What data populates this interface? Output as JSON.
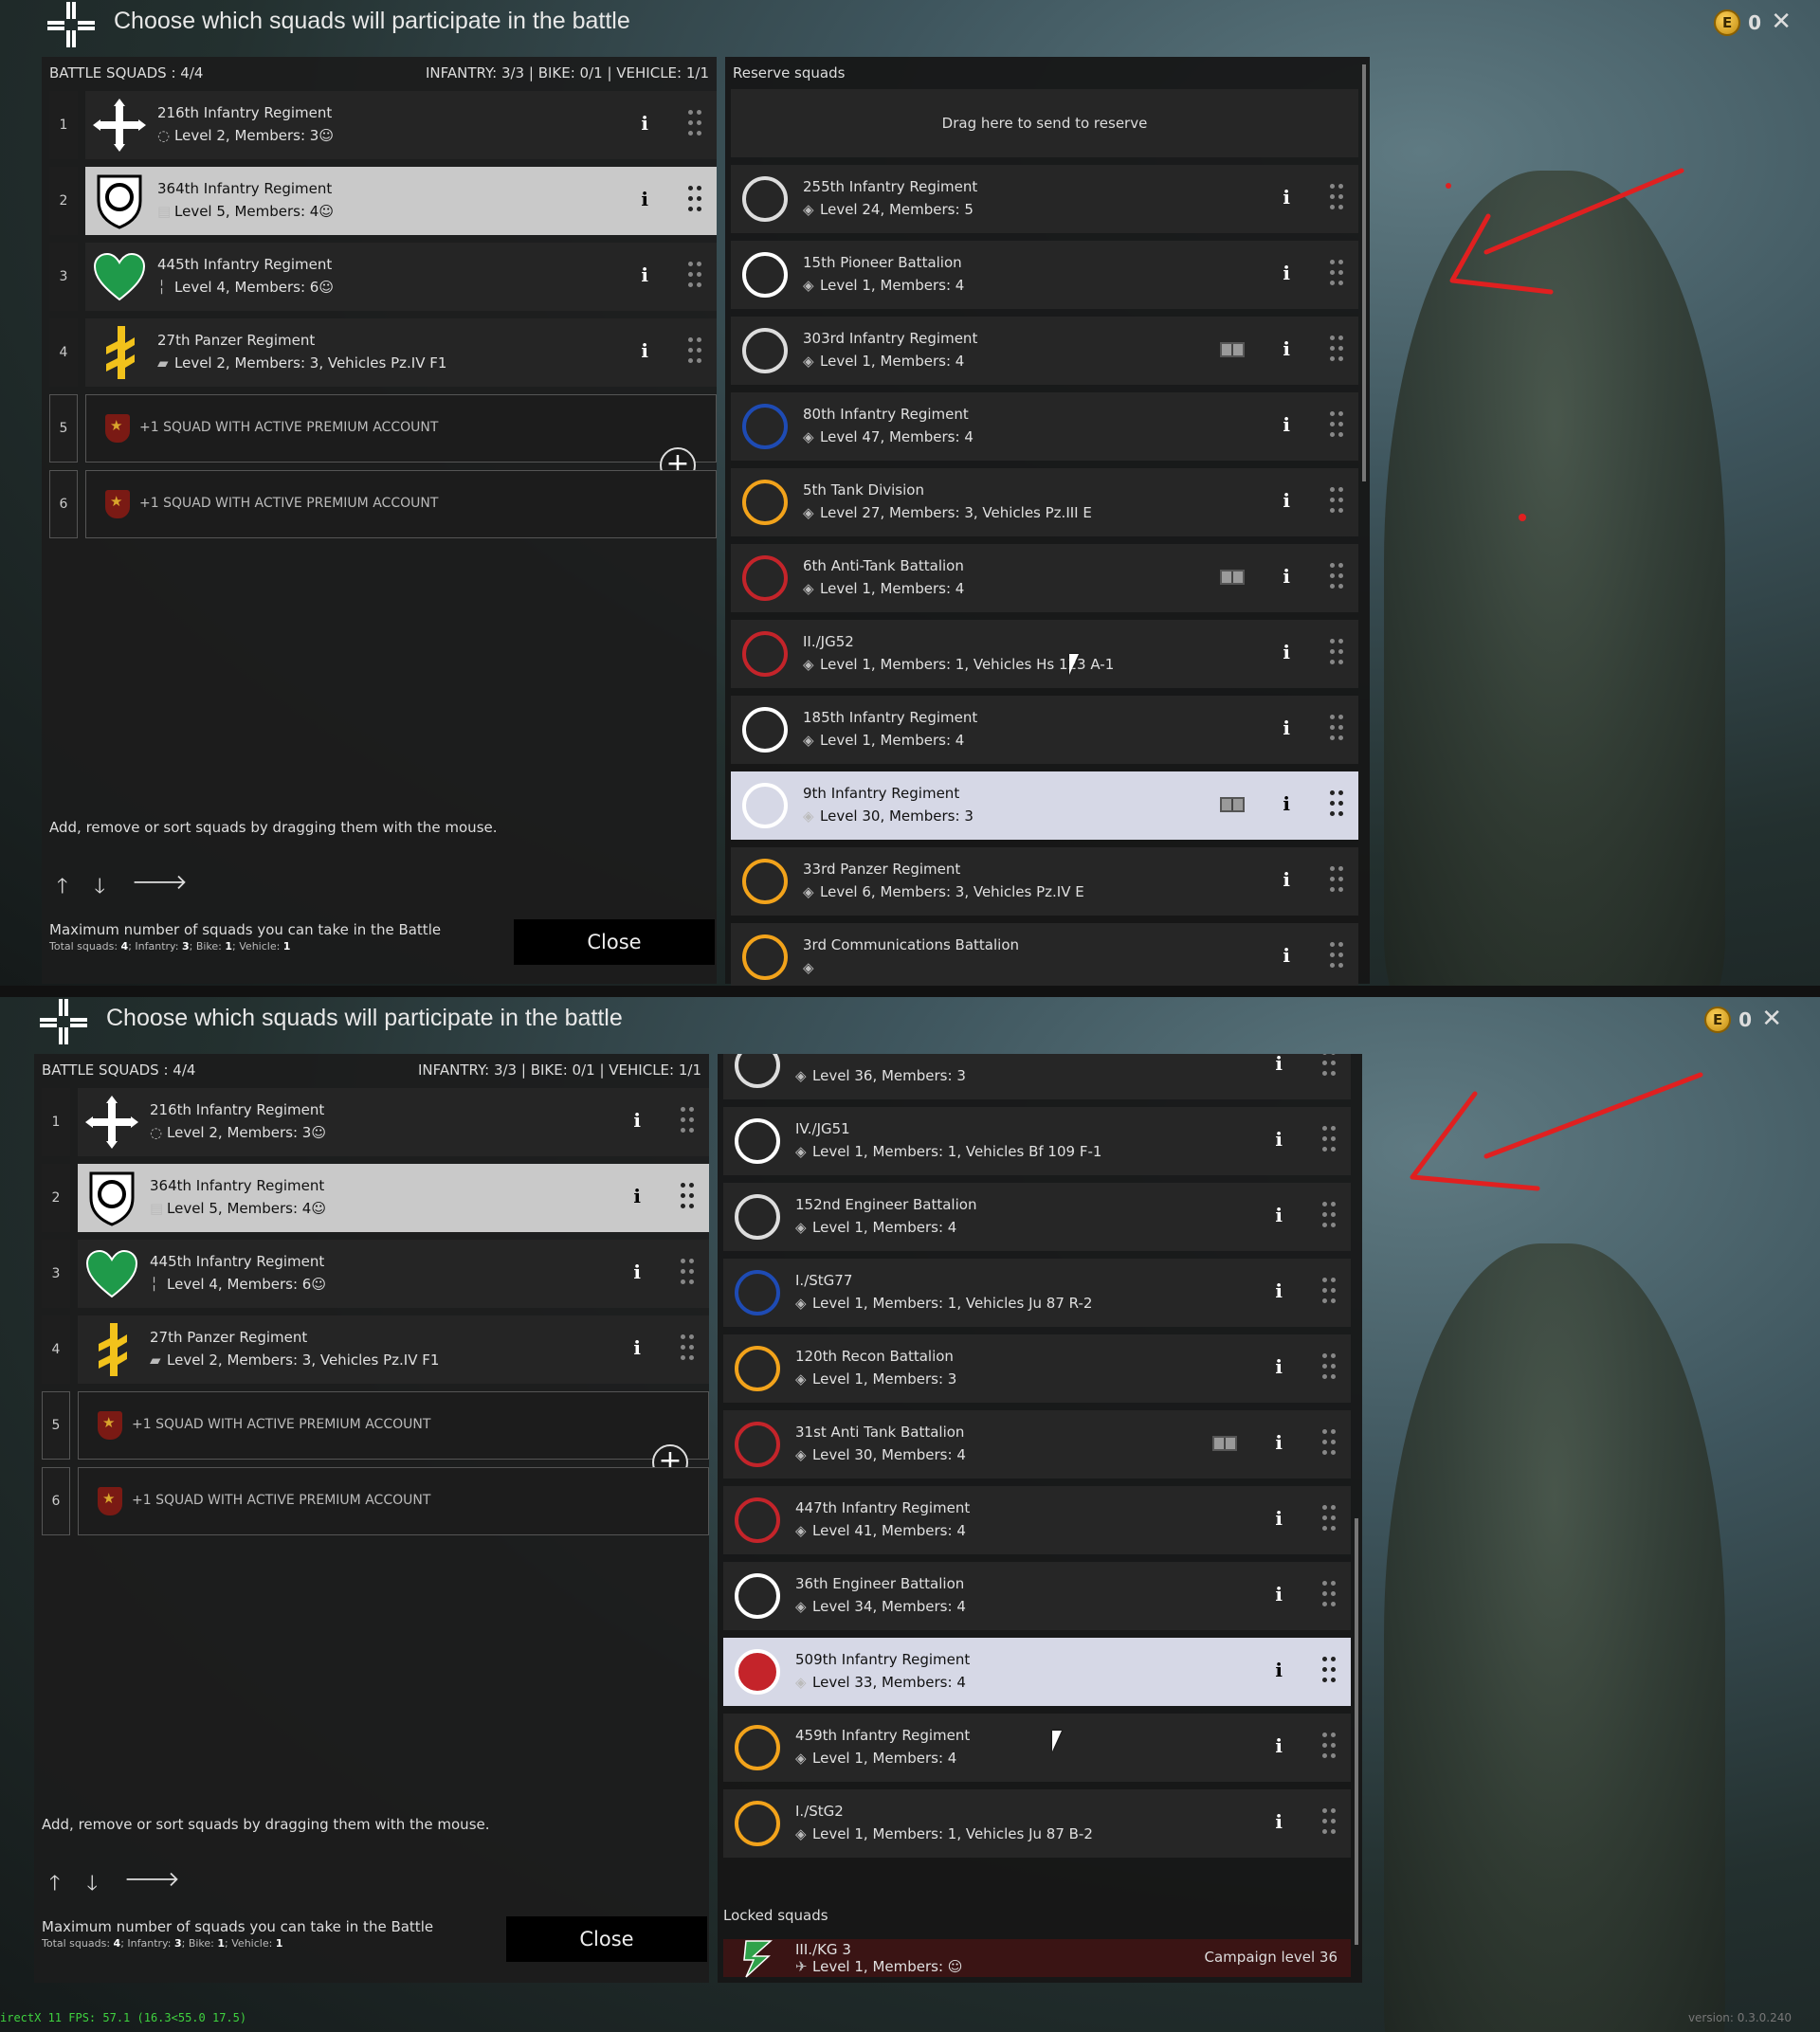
{
  "screenshots": [
    {
      "title": "Choose which squads will participate in the battle",
      "coins": "0",
      "battle_label": "BATTLE SQUADS : 4/4",
      "battle_counts": "INFANTRY: 3/3 | BIKE: 0/1 | VEHICLE: 1/1",
      "battle_squads": [
        {
          "num": "1",
          "name": "216th Infantry Regiment",
          "sub": "Level 2, Members: 3",
          "icon": "infantry-icon",
          "emblem": "white-cross"
        },
        {
          "num": "2",
          "name": "364th Infantry Regiment",
          "sub": "Level 5, Members: 4",
          "icon": "engineer-icon",
          "emblem": "shield-circle",
          "selected": true
        },
        {
          "num": "3",
          "name": "445th Infantry Regiment",
          "sub": "Level 4, Members: 6",
          "icon": "rifle-icon",
          "emblem": "green-heart"
        },
        {
          "num": "4",
          "name": "27th Panzer Regiment",
          "sub": "Level 2, Members: 3, Vehicles Pz.IV F1",
          "icon": "tank-icon",
          "emblem": "yellow-rune"
        }
      ],
      "premium_slots": [
        {
          "num": "5",
          "text": "+1 SQUAD WITH ACTIVE PREMIUM ACCOUNT"
        },
        {
          "num": "6",
          "text": "+1 SQUAD WITH ACTIVE PREMIUM ACCOUNT"
        }
      ],
      "hint": "Add, remove or sort squads by dragging them with the mouse.",
      "max_title": "Maximum number of squads you can take in the Battle",
      "max_sub_label": "Total squads:",
      "max_total": "4",
      "max_inf_label": "Infantry:",
      "max_inf": "3",
      "max_bike_label": "Bike:",
      "max_bike": "1",
      "max_veh_label": "Vehicle:",
      "max_veh": "1",
      "close": "Close",
      "reserve_label": "Reserve squads",
      "drop_zone": "Drag here to send to reserve",
      "reserve": [
        {
          "name": "255th Infantry Regiment",
          "sub": "Level 24, Members: 5"
        },
        {
          "name": "15th Pioneer Battalion",
          "sub": "Level 1, Members: 4"
        },
        {
          "name": "303rd Infantry Regiment",
          "sub": "Level 1, Members: 4",
          "book": true
        },
        {
          "name": "80th Infantry Regiment",
          "sub": "Level 47, Members: 4"
        },
        {
          "name": "5th Tank Division",
          "sub": "Level 27, Members: 3, Vehicles Pz.III E"
        },
        {
          "name": "6th Anti-Tank Battalion",
          "sub": "Level 1, Members: 4",
          "book": true
        },
        {
          "name": "II./JG52",
          "sub": "Level 1, Members: 1, Vehicles Hs 123 A-1"
        },
        {
          "name": "185th Infantry Regiment",
          "sub": "Level 1, Members: 4"
        },
        {
          "name": "9th Infantry Regiment",
          "sub": "Level 30, Members: 3",
          "book": true,
          "selected": true
        },
        {
          "name": "33rd Panzer Regiment",
          "sub": "Level 6, Members: 3, Vehicles Pz.IV E"
        },
        {
          "name": "3rd Communications Battalion",
          "sub": ""
        }
      ]
    },
    {
      "title": "Choose which squads will participate in the battle",
      "coins": "0",
      "battle_label": "BATTLE SQUADS : 4/4",
      "battle_counts": "INFANTRY: 3/3 | BIKE: 0/1 | VEHICLE: 1/1",
      "hint": "Add, remove or sort squads by dragging them with the mouse.",
      "max_title": "Maximum number of squads you can take in the Battle",
      "close": "Close",
      "reserve": [
        {
          "name": "",
          "sub": "Level 36, Members: 3"
        },
        {
          "name": "IV./JG51",
          "sub": "Level 1, Members: 1, Vehicles Bf 109 F-1"
        },
        {
          "name": "152nd Engineer Battalion",
          "sub": "Level 1, Members: 4"
        },
        {
          "name": "I./StG77",
          "sub": "Level 1, Members: 1, Vehicles Ju 87 R-2"
        },
        {
          "name": "120th Recon Battalion",
          "sub": "Level 1, Members: 3"
        },
        {
          "name": "31st Anti Tank Battalion",
          "sub": "Level 30, Members: 4",
          "book": true
        },
        {
          "name": "447th Infantry Regiment",
          "sub": "Level 41, Members: 4"
        },
        {
          "name": "36th Engineer Battalion",
          "sub": "Level 34, Members: 4"
        },
        {
          "name": "509th Infantry Regiment",
          "sub": "Level 33, Members: 4",
          "selected": true
        },
        {
          "name": "459th Infantry Regiment",
          "sub": "Level 1, Members: 4"
        },
        {
          "name": "I./StG2",
          "sub": "Level 1, Members: 1, Vehicles Ju 87 B-2"
        }
      ],
      "locked_label": "Locked squads",
      "locked": [
        {
          "name": "III./KG 3",
          "sub": "Level 1, Members: ",
          "requirement": "Campaign level 36"
        }
      ]
    }
  ],
  "footer": {
    "fps": "irectX 11 FPS: 57.1 (16.3<55.0 17.5)",
    "version": "version: 0.3.0.240"
  },
  "colors": {
    "annotation_arrow": "#e02020",
    "selected_card": "#c9c9c9",
    "selected_reserve": "#d6d8e6",
    "locked_card": "#3a1414"
  }
}
